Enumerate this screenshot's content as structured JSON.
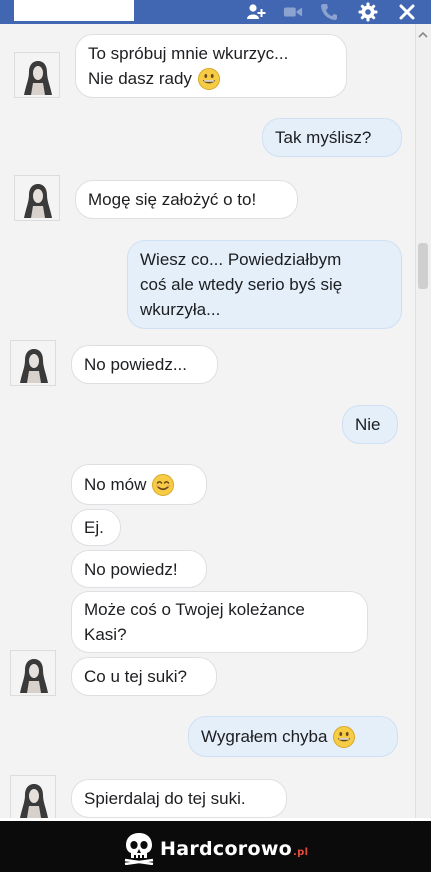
{
  "header": {
    "icons": [
      "add-people-icon",
      "video-call-icon",
      "phone-call-icon",
      "settings-gear-icon",
      "close-icon"
    ]
  },
  "messages": [
    {
      "side": "in",
      "lines": [
        "To spróbuj mnie wkurzyc...",
        "Nie dasz rady"
      ],
      "emoji": "grinning-face"
    },
    {
      "side": "out",
      "lines": [
        "Tak myślisz?"
      ]
    },
    {
      "side": "in",
      "lines": [
        "Mogę się założyć o to!"
      ]
    },
    {
      "side": "out",
      "lines": [
        "Wiesz co... Powiedziałbym",
        "coś ale wtedy serio byś się",
        "wkurzyła..."
      ]
    },
    {
      "side": "in",
      "lines": [
        "No powiedz..."
      ]
    },
    {
      "side": "out",
      "lines": [
        "Nie"
      ]
    },
    {
      "side": "in",
      "lines": [
        "No mów"
      ],
      "emoji": "smiling-face"
    },
    {
      "side": "in",
      "lines": [
        "Ej."
      ]
    },
    {
      "side": "in",
      "lines": [
        "No powiedz!"
      ]
    },
    {
      "side": "in",
      "lines": [
        "Może coś o Twojej koleżance",
        "Kasi?"
      ]
    },
    {
      "side": "in",
      "lines": [
        "Co u tej suki?"
      ]
    },
    {
      "side": "out",
      "lines": [
        "Wygrałem chyba"
      ],
      "emoji": "grinning-face"
    },
    {
      "side": "in",
      "lines": [
        "Spierdalaj do tej suki."
      ]
    }
  ],
  "footer": {
    "brand": "Hardcorowo",
    "tld": ".pl",
    "logo": "skull-logo"
  },
  "colors": {
    "header_bg": "#4267b2",
    "incoming_bg": "#ffffff",
    "outgoing_bg": "#e4effa",
    "footer_bg": "#0b0b0b",
    "tld_accent": "#e34c3c"
  }
}
